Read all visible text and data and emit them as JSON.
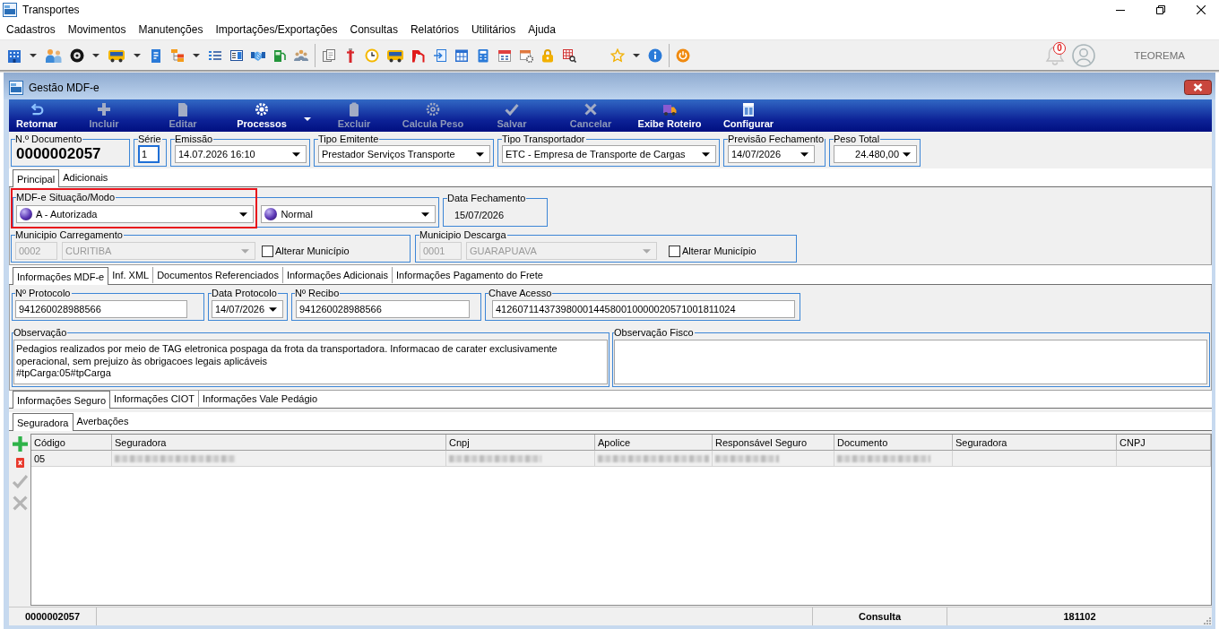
{
  "window": {
    "title": "Transportes"
  },
  "menu": [
    "Cadastros",
    "Movimentos",
    "Manutenções",
    "Importações/Exportações",
    "Consultas",
    "Relatórios",
    "Utilitários",
    "Ajuda"
  ],
  "toolbar": {
    "notification_count": "0",
    "user": "TEOREMA"
  },
  "form": {
    "title": "Gestão MDF-e"
  },
  "actions": [
    {
      "label": "Retornar",
      "disabled": false,
      "dropdown": false
    },
    {
      "label": "Incluir",
      "disabled": true,
      "dropdown": false
    },
    {
      "label": "Editar",
      "disabled": true,
      "dropdown": false
    },
    {
      "label": "Processos",
      "disabled": false,
      "dropdown": true
    },
    {
      "label": "Excluir",
      "disabled": true,
      "dropdown": false
    },
    {
      "label": "Calcula Peso",
      "disabled": true,
      "dropdown": false
    },
    {
      "label": "Salvar",
      "disabled": true,
      "dropdown": false
    },
    {
      "label": "Cancelar",
      "disabled": true,
      "dropdown": false
    },
    {
      "label": "Exibe Roteiro",
      "disabled": false,
      "dropdown": false
    },
    {
      "label": "Configurar",
      "disabled": false,
      "dropdown": false
    }
  ],
  "header_fields": [
    {
      "label": "N.º Documento",
      "kind": "display",
      "value": "0000002057",
      "focused": false
    },
    {
      "label": "Série",
      "kind": "input",
      "value": "1",
      "focused": true
    },
    {
      "label": "Emissão",
      "kind": "combo",
      "value": "14.07.2026 16:10",
      "focused": false
    },
    {
      "label": "Tipo Emitente",
      "kind": "combo",
      "value": "Prestador Serviços Transporte",
      "focused": false
    },
    {
      "label": "Tipo Transportador",
      "kind": "combo",
      "value": "ETC - Empresa de Transporte de Cargas",
      "focused": false
    },
    {
      "label": "Previsão Fechamento",
      "kind": "combo",
      "value": "14/07/2026",
      "focused": false
    },
    {
      "label": "Peso Total",
      "kind": "combo",
      "value": "24.480,00",
      "focused": false
    }
  ],
  "main_tabs": [
    {
      "label": "Principal",
      "selected": true
    },
    {
      "label": "Adicionais",
      "selected": false
    }
  ],
  "situacao_modo": {
    "label": "MDF-e Situação/Modo",
    "highlighted": true,
    "situacao": "A - Autorizada",
    "modo": "Normal"
  },
  "data_fechamento": {
    "label": "Data Fechamento",
    "value": "15/07/2026"
  },
  "municipios": [
    {
      "label": "Municipio Carregamento",
      "code": "0002",
      "city": "CURITIBA",
      "disabled": true,
      "option": {
        "label": "Alterar Município",
        "checked": false
      }
    },
    {
      "label": "Municipio Descarga",
      "code": "0001",
      "city": "GUARAPUAVA",
      "disabled": true,
      "option": {
        "label": "Alterar Município",
        "checked": false
      }
    }
  ],
  "info_tabs": [
    {
      "label": "Informações MDF-e",
      "selected": true
    },
    {
      "label": "Inf. XML",
      "selected": false
    },
    {
      "label": "Documentos Referenciados",
      "selected": false
    },
    {
      "label": "Informações Adicionais",
      "selected": false
    },
    {
      "label": "Informações Pagamento do Frete",
      "selected": false
    }
  ],
  "info_fields": [
    {
      "label": "Nº Protocolo",
      "kind": "input",
      "value": "941260028988566"
    },
    {
      "label": "Data Protocolo",
      "kind": "combo",
      "value": "14/07/2026"
    },
    {
      "label": "Nº Recibo",
      "kind": "input",
      "value": "941260028988566"
    },
    {
      "label": "Chave Acesso",
      "kind": "input",
      "value": "41260711437398000144580010000020571001811024"
    }
  ],
  "observacao": {
    "label": "Observação",
    "lines": [
      "Pedagios realizados por meio de TAG eletronica pospaga da frota da transportadora. Informacao de carater exclusivamente",
      "operacional, sem prejuizo às obrigacoes legais aplicáveis",
      "#tpCarga:05#tpCarga"
    ]
  },
  "observacao_fisco": {
    "label": "Observação Fisco"
  },
  "seguro_tabs": [
    {
      "label": "Informações Seguro",
      "selected": true
    },
    {
      "label": "Informações CIOT",
      "selected": false
    },
    {
      "label": "Informações Vale Pedágio",
      "selected": false
    }
  ],
  "seguradora_tabs": [
    {
      "label": "Seguradora",
      "selected": true
    },
    {
      "label": "Averbações",
      "selected": false
    }
  ],
  "grid_tools": [
    {
      "kind": "add",
      "disabled": false
    },
    {
      "kind": "delete",
      "disabled": false
    },
    {
      "kind": "confirm",
      "disabled": true
    },
    {
      "kind": "cancel",
      "disabled": true
    }
  ],
  "grid": {
    "columns": [
      "Código",
      "Seguradora",
      "Cnpj",
      "Apolice",
      "Responsável Seguro",
      "Documento",
      "Seguradora",
      "CNPJ"
    ],
    "rows": [
      {
        "cells": [
          {
            "kind": "text",
            "text": "05"
          },
          {
            "kind": "redacted"
          },
          {
            "kind": "redacted"
          },
          {
            "kind": "redacted"
          },
          {
            "kind": "redacted"
          },
          {
            "kind": "redacted"
          },
          {
            "kind": "empty"
          },
          {
            "kind": "empty"
          }
        ]
      }
    ]
  },
  "status_bar": {
    "document": "0000002057",
    "mode": "Consulta",
    "code": "181102"
  }
}
